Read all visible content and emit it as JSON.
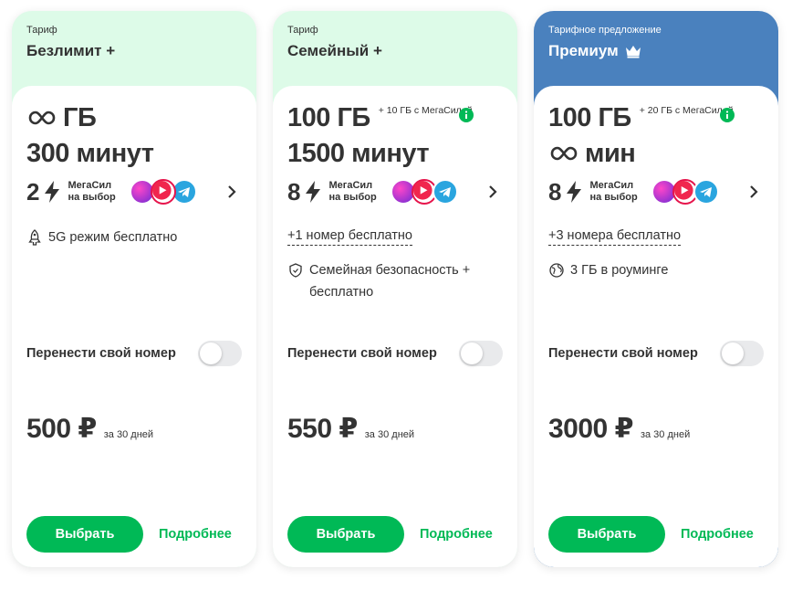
{
  "colors": {
    "accent": "#00b956",
    "header_mint": "#ddfbe8",
    "header_blue": "#4a81be",
    "text": "#333333"
  },
  "icons": [
    "infinity-icon",
    "info-icon",
    "lightning-icon",
    "chevron-right-icon",
    "rocket-icon",
    "shield-icon",
    "globe-icon",
    "crown-icon",
    "app-icons"
  ],
  "cards": [
    {
      "eyebrow": "Тариф",
      "name": "Безлимит +",
      "data_amount": "ГБ",
      "minutes": "300 минут",
      "mega_count": "2",
      "mega_label": "МегаСил на выбор",
      "features": [
        "5G режим бесплатно"
      ],
      "transfer_label": "Перенести свой номер",
      "transfer_enabled": false,
      "price": "500 ₽",
      "period": "за 30 дней",
      "select_label": "Выбрать",
      "more_label": "Подробнее"
    },
    {
      "eyebrow": "Тариф",
      "name": "Семейный +",
      "data_amount": "100 ГБ",
      "bonus": "+ 10 ГБ с МегаСилой",
      "minutes": "1500 минут",
      "mega_count": "8",
      "mega_label": "МегаСил на выбор",
      "features": [
        "+1 номер бесплатно",
        "Семейная безопасность + бесплатно"
      ],
      "transfer_label": "Перенести свой номер",
      "transfer_enabled": false,
      "price": "550 ₽",
      "period": "за 30 дней",
      "select_label": "Выбрать",
      "more_label": "Подробнее"
    },
    {
      "eyebrow": "Тарифное предложение",
      "name": "Премиум",
      "data_amount": "100 ГБ",
      "bonus": "+ 20 ГБ с МегаСилой",
      "minutes": "мин",
      "mega_count": "8",
      "mega_label": "МегаСил на выбор",
      "features": [
        "+3 номера бесплатно",
        "3 ГБ в роуминге"
      ],
      "transfer_label": "Перенести свой номер",
      "transfer_enabled": false,
      "price": "3000 ₽",
      "period": "за 30 дней",
      "select_label": "Выбрать",
      "more_label": "Подробнее"
    }
  ]
}
